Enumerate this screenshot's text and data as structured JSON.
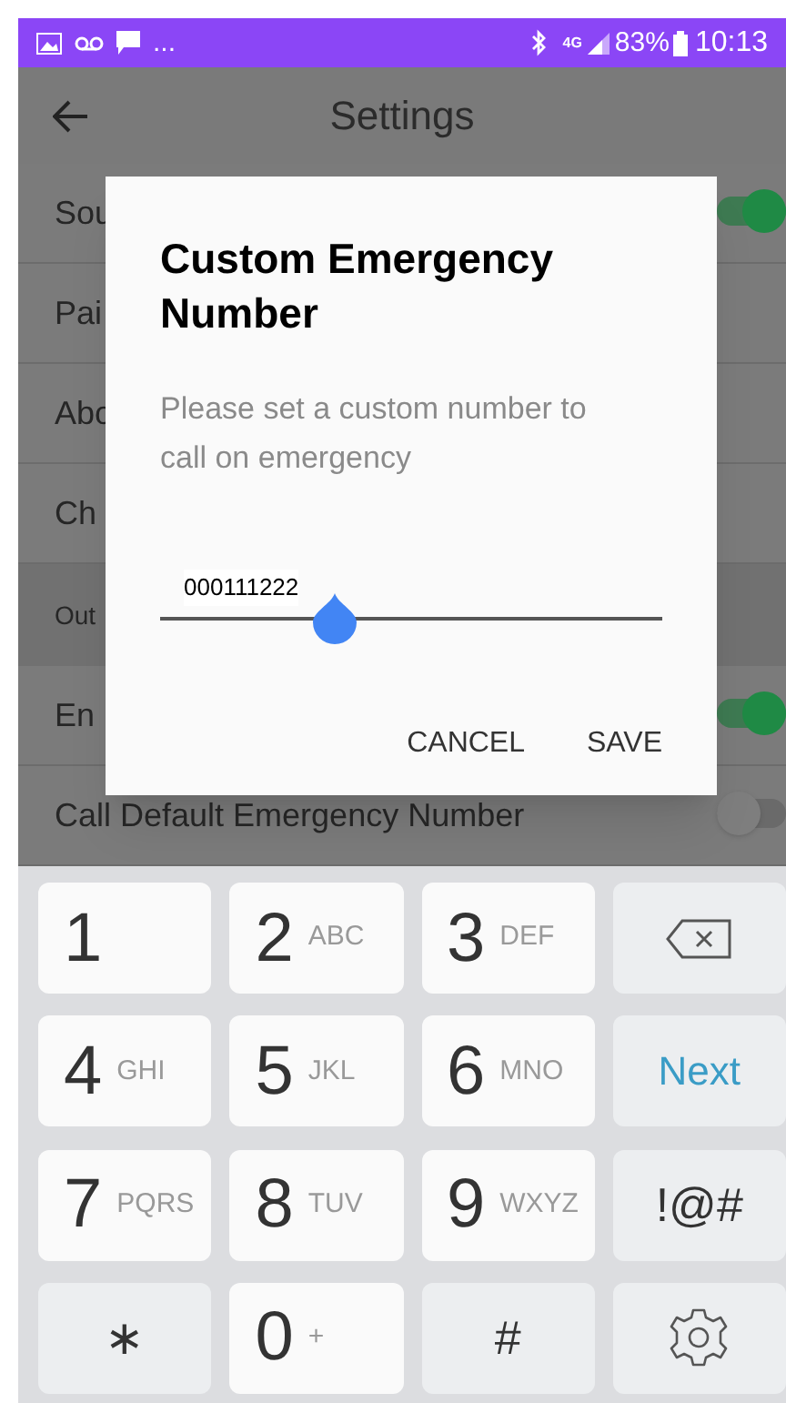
{
  "status_bar": {
    "more": "...",
    "network": "4G",
    "battery": "83%",
    "time": "10:13"
  },
  "header": {
    "title": "Settings"
  },
  "settings": [
    {
      "kind": "toggle",
      "label": "Sou",
      "on": true
    },
    {
      "kind": "item",
      "label": "Pai"
    },
    {
      "kind": "item",
      "label": "Abo"
    },
    {
      "kind": "item",
      "label": "Ch"
    },
    {
      "kind": "section",
      "label": "Out"
    },
    {
      "kind": "toggle",
      "label": "En",
      "on": true
    },
    {
      "kind": "toggle",
      "label": "Call Default Emergency Number",
      "on": false
    }
  ],
  "dialog": {
    "title": "Custom Emergency Number",
    "message": "Please set a custom number to call on emergency",
    "value": "000111222",
    "buttons": [
      "CANCEL",
      "SAVE"
    ]
  },
  "keyboard": [
    {
      "kind": "digit",
      "main": "1"
    },
    {
      "kind": "digit",
      "main": "2",
      "sub": "ABC"
    },
    {
      "kind": "digit",
      "main": "3",
      "sub": "DEF"
    },
    {
      "kind": "backspace"
    },
    {
      "kind": "digit",
      "main": "4",
      "sub": "GHI"
    },
    {
      "kind": "digit",
      "main": "5",
      "sub": "JKL"
    },
    {
      "kind": "digit",
      "main": "6",
      "sub": "MNO"
    },
    {
      "kind": "action",
      "main": "Next"
    },
    {
      "kind": "digit",
      "main": "7",
      "sub": "PQRS"
    },
    {
      "kind": "digit",
      "main": "8",
      "sub": "TUV"
    },
    {
      "kind": "digit",
      "main": "9",
      "sub": "WXYZ"
    },
    {
      "kind": "symbol",
      "main": "!@#"
    },
    {
      "kind": "symbol",
      "main": "∗"
    },
    {
      "kind": "digit",
      "main": "0",
      "sub": "+"
    },
    {
      "kind": "symbol",
      "main": "#"
    },
    {
      "kind": "settings"
    }
  ]
}
